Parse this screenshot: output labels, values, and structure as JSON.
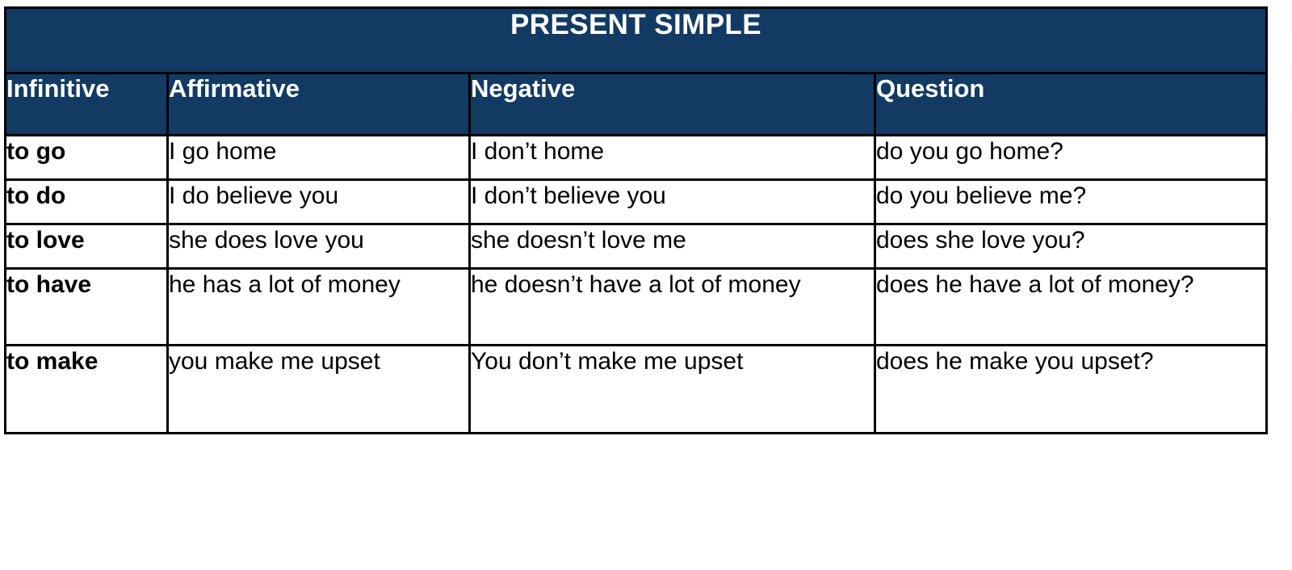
{
  "table": {
    "title": "PRESENT SIMPLE",
    "accent_color": "#123A62",
    "border_color": "#000000",
    "text_color": "#000000",
    "header_text_color": "#FFFFFF",
    "columns": [
      {
        "key": "infinitive",
        "label": "Infinitive"
      },
      {
        "key": "affirmative",
        "label": "Affirmative"
      },
      {
        "key": "negative",
        "label": "Negative"
      },
      {
        "key": "question",
        "label": "Question"
      }
    ],
    "rows": [
      {
        "infinitive": "to go",
        "affirmative": "I go home",
        "negative": "I don’t home",
        "question": "do you go home?"
      },
      {
        "infinitive": "to do",
        "affirmative": "I do believe you",
        "negative": "I don’t believe you",
        "question": "do you believe me?"
      },
      {
        "infinitive": "to love",
        "affirmative": "she does love you",
        "negative": "she doesn’t love me",
        "question": "does she love you?"
      },
      {
        "infinitive": "to have",
        "affirmative": "he has a lot of money",
        "negative": "he doesn’t have a lot of money",
        "question": "does he have a lot of money?"
      },
      {
        "infinitive": "to make",
        "affirmative": "you make me upset",
        "negative": "You don’t make me upset",
        "question": "does he make you upset?"
      }
    ]
  }
}
